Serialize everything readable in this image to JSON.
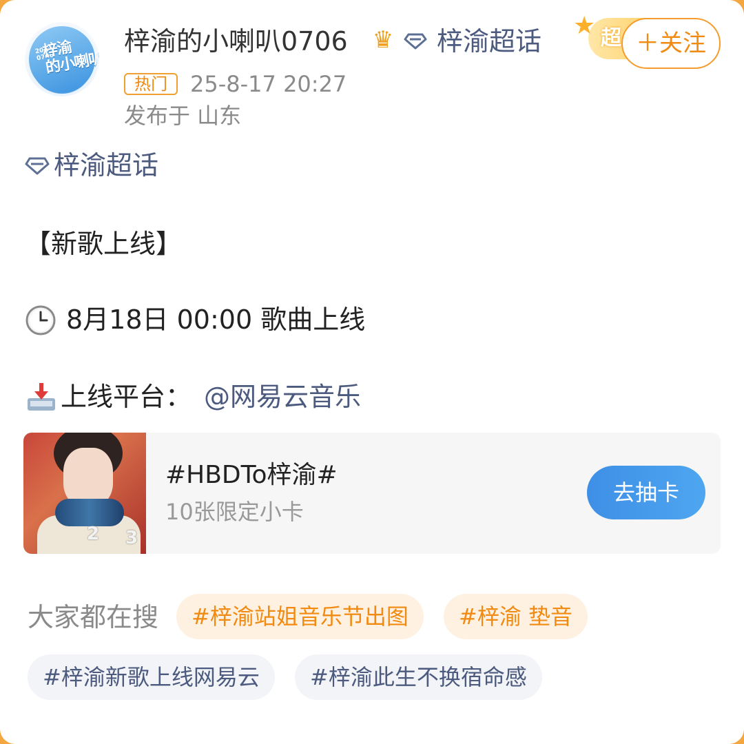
{
  "header": {
    "username": "梓渝的小喇叭0706",
    "avatar_text": "梓渝\n的小喇叭",
    "avatar_small_text": "2002\n0706",
    "supertopic_link": "梓渝超话",
    "super_badge": "超",
    "follow_button": "＋关注",
    "hot_badge": "热门",
    "post_time": "25-8-17 20:27",
    "location": "发布于 山东"
  },
  "body": {
    "supertopic_tag": "梓渝超话",
    "headline": "【新歌上线】",
    "release_time": "8月18日 00:00 歌曲上线",
    "platform_label": "上线平台：",
    "platform_link": "@网易云音乐"
  },
  "promo": {
    "title": "#HBDTo梓渝#",
    "subtitle": "10张限定小卡",
    "button": "去抽卡",
    "photo_numbers": [
      "2",
      "3"
    ]
  },
  "searches": {
    "label": "大家都在搜",
    "chips": [
      {
        "text": "#梓渝站姐音乐节出图",
        "style": "hot"
      },
      {
        "text": "#梓渝 垫音",
        "style": "hot"
      },
      {
        "text": "#梓渝新歌上线网易云",
        "style": "plain"
      },
      {
        "text": "#梓渝此生不换宿命感",
        "style": "plain"
      }
    ]
  },
  "icons": {
    "crown": "crown-icon",
    "diamond": "diamond-icon",
    "clock": "clock-icon",
    "inbox": "inbox-tray-icon"
  },
  "colors": {
    "accent_orange": "#f08a10",
    "link_blue": "#4b5a7e",
    "button_blue": "#4296ea",
    "frame_orange": "#f4a640"
  }
}
